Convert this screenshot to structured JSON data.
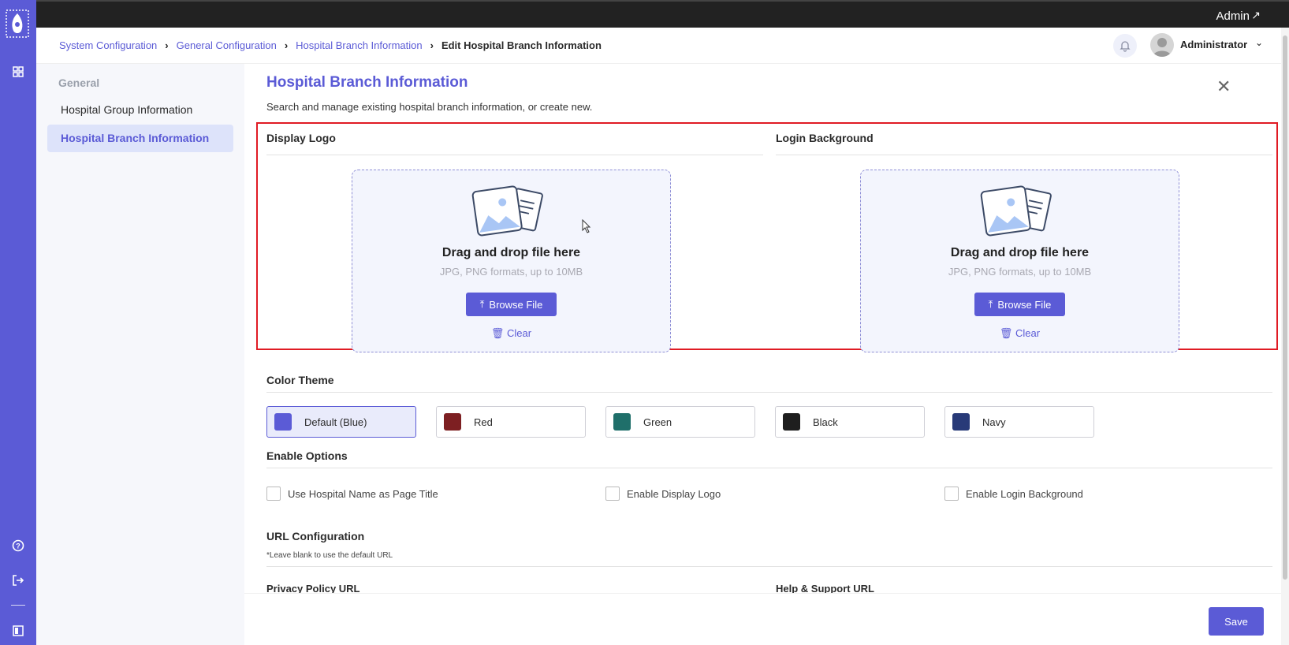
{
  "topbar": {
    "user_link": "Admin",
    "user_link_icon": "external-arrow-icon"
  },
  "breadcrumb": [
    {
      "label": "System Configuration"
    },
    {
      "label": "General Configuration"
    },
    {
      "label": "Hospital Branch Information"
    },
    {
      "label": "Edit Hospital Branch Information"
    }
  ],
  "header": {
    "user_name": "Administrator"
  },
  "sidebar": {
    "group": "General",
    "items": [
      {
        "label": "Hospital Group Information",
        "active": false
      },
      {
        "label": "Hospital Branch Information",
        "active": true
      }
    ]
  },
  "page": {
    "title": "Hospital Branch Information",
    "subtitle": "Search and manage existing hospital branch information, or create new."
  },
  "uploads": [
    {
      "heading": "Display Logo",
      "drop_title": "Drag and drop file here",
      "hint": "JPG, PNG formats, up to 10MB",
      "browse_label": "Browse File",
      "clear_label": "Clear"
    },
    {
      "heading": "Login Background",
      "drop_title": "Drag and drop file here",
      "hint": "JPG, PNG formats, up to 10MB",
      "browse_label": "Browse File",
      "clear_label": "Clear"
    }
  ],
  "color_theme": {
    "heading": "Color Theme",
    "options": [
      {
        "label": "Default (Blue)",
        "color": "#5b5bd6",
        "selected": true
      },
      {
        "label": "Red",
        "color": "#7d1f22",
        "selected": false
      },
      {
        "label": "Green",
        "color": "#1f6f6a",
        "selected": false
      },
      {
        "label": "Black",
        "color": "#1e1e1e",
        "selected": false
      },
      {
        "label": "Navy",
        "color": "#283a78",
        "selected": false
      }
    ]
  },
  "enable_options": {
    "heading": "Enable Options",
    "items": [
      {
        "label": "Use Hospital Name as Page Title",
        "checked": false
      },
      {
        "label": "Enable Display Logo",
        "checked": false
      },
      {
        "label": "Enable Login Background",
        "checked": false
      }
    ]
  },
  "url_config": {
    "heading": "URL Configuration",
    "note": "*Leave blank to use the default URL",
    "privacy_label": "Privacy Policy URL",
    "help_label": "Help & Support URL"
  },
  "footer": {
    "save_label": "Save"
  },
  "colors": {
    "accent": "#5b5bd6",
    "highlight_box": "#e01b24",
    "topbar": "#222222"
  }
}
